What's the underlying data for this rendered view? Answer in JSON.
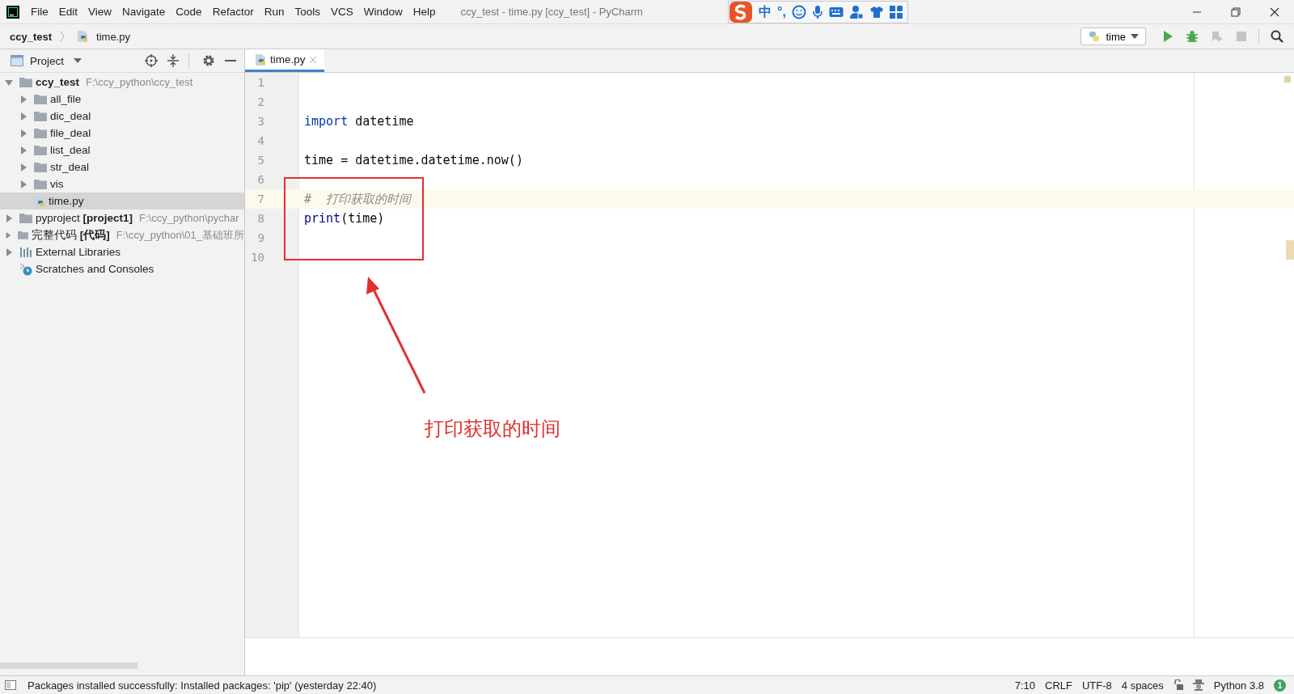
{
  "window": {
    "title": "ccy_test - time.py [ccy_test] - PyCharm"
  },
  "menu": [
    "File",
    "Edit",
    "View",
    "Navigate",
    "Code",
    "Refactor",
    "Run",
    "Tools",
    "VCS",
    "Window",
    "Help"
  ],
  "ime_toolbar": {
    "mode": "中",
    "punctuation": "°,"
  },
  "breadcrumbs": [
    "ccy_test",
    "time.py"
  ],
  "run_config": {
    "name": "time"
  },
  "project_panel": {
    "title": "Project"
  },
  "tree": [
    {
      "kind": "folder",
      "name": "ccy_test",
      "bold": true,
      "path": "F:\\ccy_python\\ccy_test",
      "expanded": true,
      "selected": false,
      "children": [
        {
          "kind": "folder",
          "name": "all_file",
          "expanded": false,
          "selected": false
        },
        {
          "kind": "folder",
          "name": "dic_deal",
          "expanded": false,
          "selected": false
        },
        {
          "kind": "folder",
          "name": "file_deal",
          "expanded": false,
          "selected": false
        },
        {
          "kind": "folder",
          "name": "list_deal",
          "expanded": false,
          "selected": false
        },
        {
          "kind": "folder",
          "name": "str_deal",
          "expanded": false,
          "selected": false
        },
        {
          "kind": "folder",
          "name": "vis",
          "expanded": false,
          "selected": false
        },
        {
          "kind": "file",
          "name": "time.py",
          "selected": true
        }
      ]
    },
    {
      "kind": "folder",
      "name": "pyproject **[project1]**",
      "bold": false,
      "path": "F:\\ccy_python\\pychar",
      "expanded": false,
      "selected": false
    },
    {
      "kind": "folder",
      "name": "完整代码 **[代码]**",
      "bold": false,
      "path": "F:\\ccy_python\\01_基础班所",
      "expanded": false,
      "selected": false
    },
    {
      "kind": "libraries",
      "name": "External Libraries",
      "expanded": false,
      "selected": false
    },
    {
      "kind": "scratches",
      "name": "Scratches and Consoles",
      "selected": false
    }
  ],
  "tabs": [
    {
      "label": "time.py",
      "selected": true
    }
  ],
  "code": [
    {
      "number": "1",
      "current": false
    },
    {
      "number": "2",
      "current": false
    },
    {
      "number": "3",
      "current": false,
      "tokens": [
        {
          "kind": "keyword",
          "text": "import"
        },
        {
          "kind": "plain",
          "text": " datetime"
        }
      ]
    },
    {
      "number": "4",
      "current": false
    },
    {
      "number": "5",
      "current": false,
      "tokens": [
        {
          "kind": "plain",
          "text": "time = datetime.datetime.now()"
        }
      ]
    },
    {
      "number": "6",
      "current": false
    },
    {
      "number": "7",
      "current": true,
      "tokens": [
        {
          "kind": "comment",
          "text": "#  打印获取的时间"
        }
      ]
    },
    {
      "number": "8",
      "current": false,
      "tokens": [
        {
          "kind": "builtin",
          "text": "print"
        },
        {
          "kind": "plain",
          "text": "(time)"
        }
      ]
    },
    {
      "number": "9",
      "current": false
    },
    {
      "number": "10",
      "current": false
    }
  ],
  "annotation": {
    "text": "打印获取的时间"
  },
  "status_bar": {
    "message": "Packages installed successfully: Installed packages: 'pip' (yesterday 22:40)",
    "position": "7:10",
    "line_separator": "CRLF",
    "encoding": "UTF-8",
    "indent": "4 spaces",
    "interpreter": "Python 3.8",
    "notifications": "1"
  }
}
